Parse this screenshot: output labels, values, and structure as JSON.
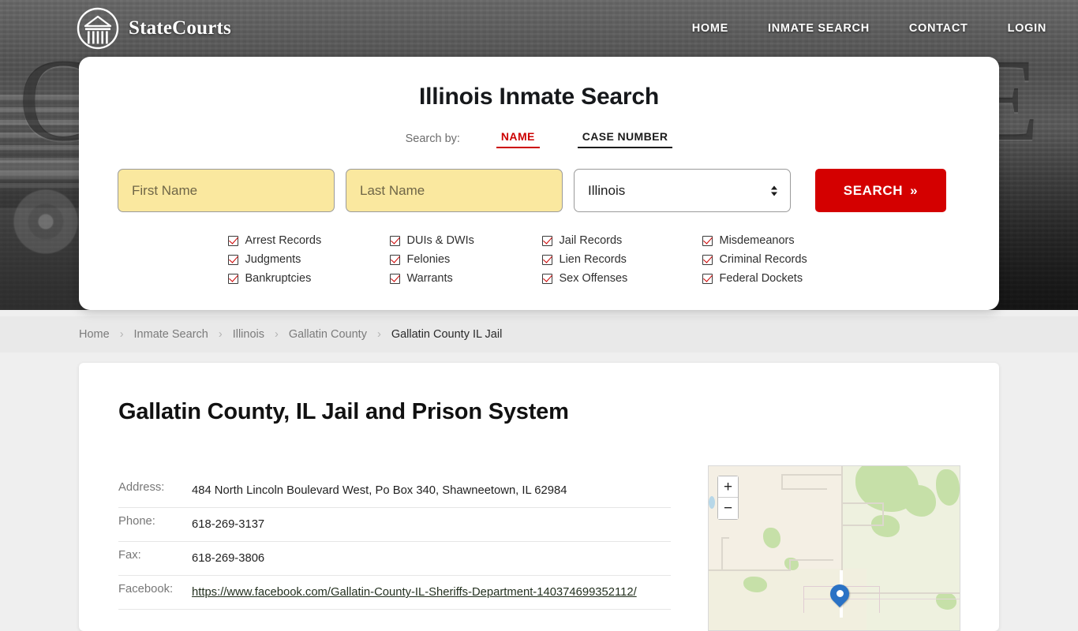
{
  "brand": {
    "name": "StateCourts",
    "logo_icon": "courthouse-circle-icon"
  },
  "nav": [
    {
      "label": "HOME"
    },
    {
      "label": "INMATE SEARCH"
    },
    {
      "label": "CONTACT"
    },
    {
      "label": "LOGIN"
    }
  ],
  "search_card": {
    "title": "Illinois Inmate Search",
    "search_by_label": "Search by:",
    "tabs": [
      {
        "label": "NAME",
        "active": true
      },
      {
        "label": "CASE NUMBER",
        "active": false
      }
    ],
    "first_name_placeholder": "First Name",
    "first_name_value": "",
    "last_name_placeholder": "Last Name",
    "last_name_value": "",
    "state_selected": "Illinois",
    "search_button": "SEARCH",
    "search_button_chevron": "»",
    "accent_color": "#cc0000",
    "button_color": "#d40000",
    "field_color": "#fae89f",
    "checkboxes": [
      "Arrest Records",
      "DUIs & DWIs",
      "Jail Records",
      "Misdemeanors",
      "Judgments",
      "Felonies",
      "Lien Records",
      "Criminal Records",
      "Bankruptcies",
      "Warrants",
      "Sex Offenses",
      "Federal Dockets"
    ]
  },
  "breadcrumb": {
    "separator": "›",
    "items": [
      {
        "label": "Home",
        "current": false
      },
      {
        "label": "Inmate Search",
        "current": false
      },
      {
        "label": "Illinois",
        "current": false
      },
      {
        "label": "Gallatin County",
        "current": false
      },
      {
        "label": "Gallatin County IL Jail",
        "current": true
      }
    ]
  },
  "content": {
    "page_title": "Gallatin County, IL Jail and Prison System",
    "details": [
      {
        "label": "Address:",
        "value": "484 North Lincoln Boulevard West, Po Box 340, Shawneetown, IL 62984",
        "is_link": false
      },
      {
        "label": "Phone:",
        "value": "618-269-3137",
        "is_link": false
      },
      {
        "label": "Fax:",
        "value": "618-269-3806",
        "is_link": false
      },
      {
        "label": "Facebook:",
        "value": "https://www.facebook.com/Gallatin-County-IL-Sheriffs-Department-140374699352112/",
        "is_link": true
      }
    ]
  },
  "map": {
    "zoom_in_label": "+",
    "zoom_out_label": "−",
    "marker_icon": "map-pin-icon"
  },
  "hero": {
    "engraved_text": "COURT HOUSE"
  }
}
